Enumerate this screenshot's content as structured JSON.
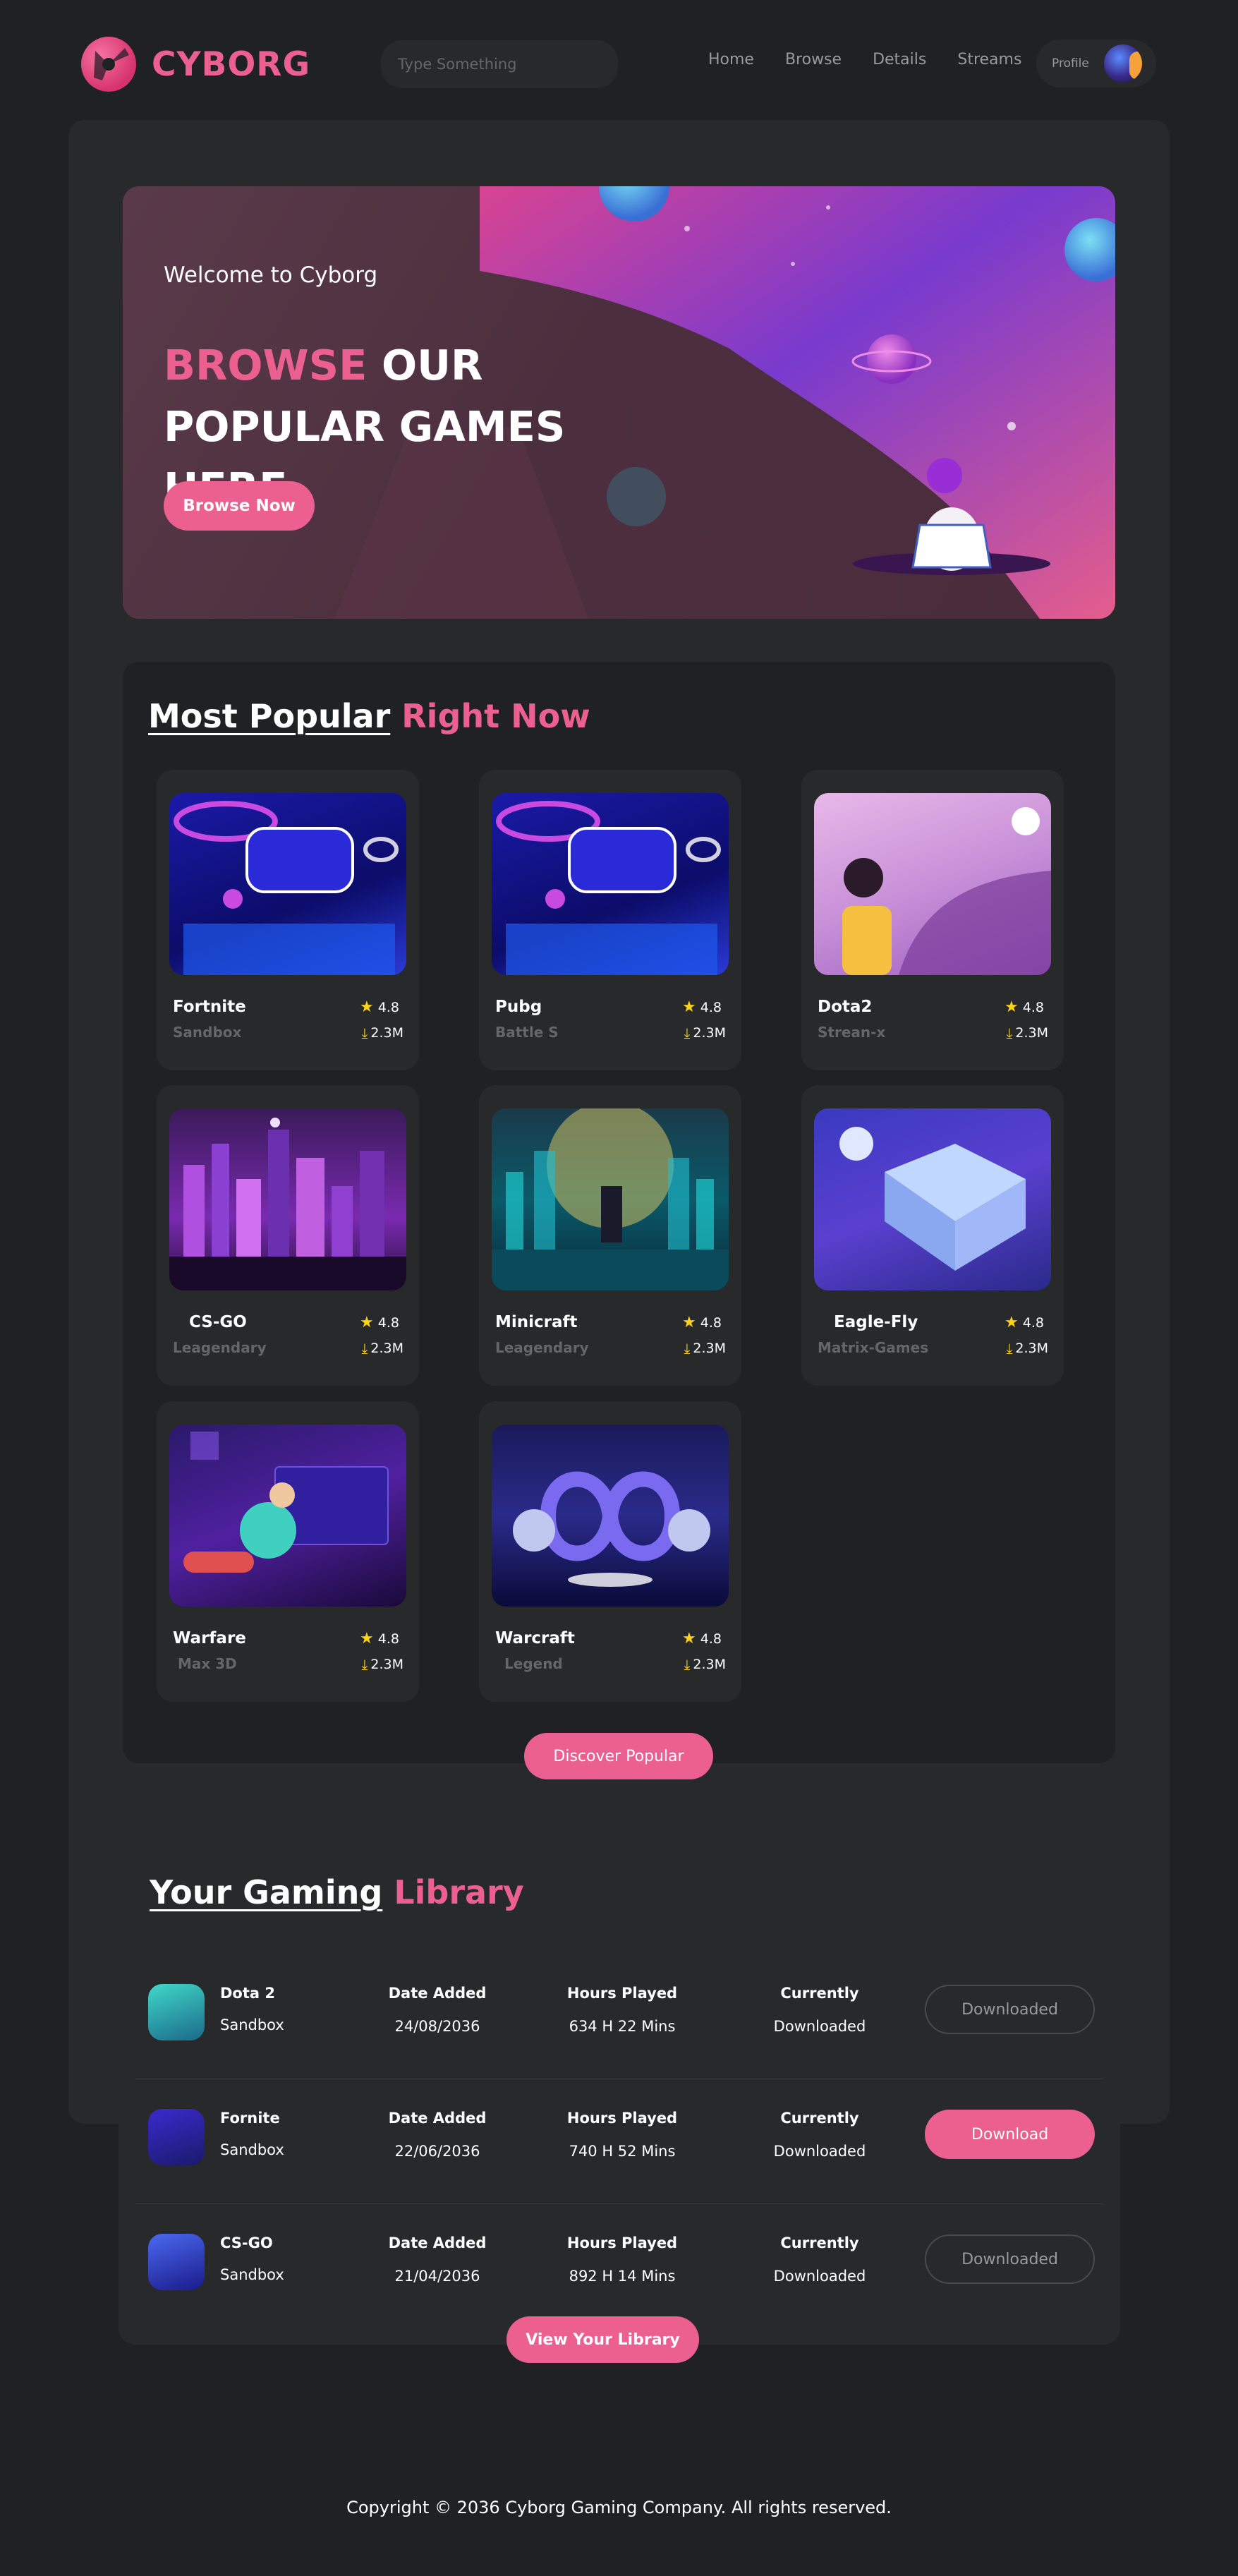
{
  "header": {
    "logo_text": "CYBORG",
    "search_placeholder": "Type Something",
    "nav": [
      "Home",
      "Browse",
      "Details",
      "Streams"
    ],
    "profile_label": "Profile"
  },
  "hero": {
    "welcome": "Welcome to Cyborg",
    "title_pink": "BROWSE",
    "title_rest": " OUR POPULAR GAMES HERE",
    "button": "Browse Now"
  },
  "popular": {
    "title_white": "Most Popular",
    "title_pink": "Right Now",
    "games": [
      {
        "name": "Fortnite",
        "category": "Sandbox",
        "rating": "4.8",
        "downloads": "2.3M"
      },
      {
        "name": "Pubg",
        "category": "Battle S",
        "rating": "4.8",
        "downloads": "2.3M"
      },
      {
        "name": "Dota2",
        "category": "Strean-x",
        "rating": "4.8",
        "downloads": "2.3M"
      },
      {
        "name": "CS-GO",
        "category": "Leagendary",
        "rating": "4.8",
        "downloads": "2.3M"
      },
      {
        "name": "Minicraft",
        "category": "Leagendary",
        "rating": "4.8",
        "downloads": "2.3M"
      },
      {
        "name": "Eagle-Fly",
        "category": "Matrix-Games",
        "rating": "4.8",
        "downloads": "2.3M"
      },
      {
        "name": "Warfare",
        "category": "Max 3D",
        "rating": "4.8",
        "downloads": "2.3M"
      },
      {
        "name": "Warcraft",
        "category": "Legend",
        "rating": "4.8",
        "downloads": "2.3M"
      }
    ],
    "button": "Discover Popular"
  },
  "library": {
    "title_white": "Your Gaming",
    "title_pink": "Library",
    "col_date": "Date Added",
    "col_hours": "Hours Played",
    "col_status": "Currently",
    "rows": [
      {
        "name": "Dota 2",
        "category": "Sandbox",
        "date": "24/08/2036",
        "hours": "634 H 22 Mins",
        "status": "Downloaded",
        "button": "Downloaded"
      },
      {
        "name": "Fornite",
        "category": "Sandbox",
        "date": "22/06/2036",
        "hours": "740 H 52 Mins",
        "status": "Downloaded",
        "button": "Download"
      },
      {
        "name": "CS-GO",
        "category": "Sandbox",
        "date": "21/04/2036",
        "hours": "892 H 14 Mins",
        "status": "Downloaded",
        "button": "Downloaded"
      }
    ],
    "button": "View Your Library"
  },
  "footer": "Copyright © 2036 Cyborg Gaming Company. All rights reserved.",
  "colors": {
    "accent": "#ec6090",
    "star": "#fcd21a",
    "background": "#1f2122",
    "panel": "#27292a"
  },
  "icons": [
    "search-icon",
    "star-icon",
    "download-icon"
  ]
}
